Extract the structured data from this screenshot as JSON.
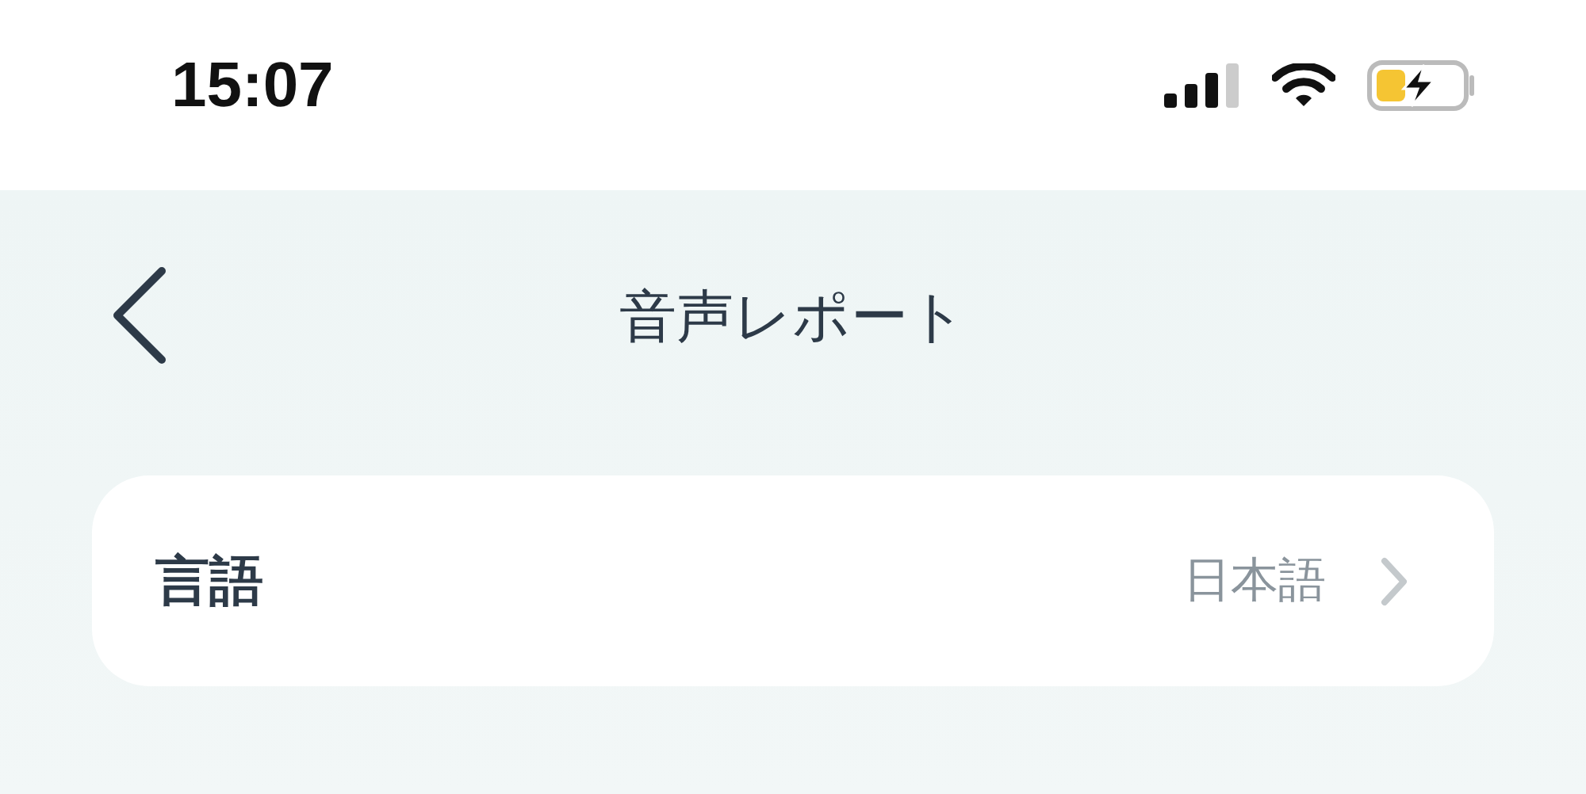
{
  "status_bar": {
    "time": "15:07"
  },
  "nav": {
    "title": "音声レポート"
  },
  "settings": [
    {
      "label": "言語",
      "value": "日本語"
    }
  ]
}
